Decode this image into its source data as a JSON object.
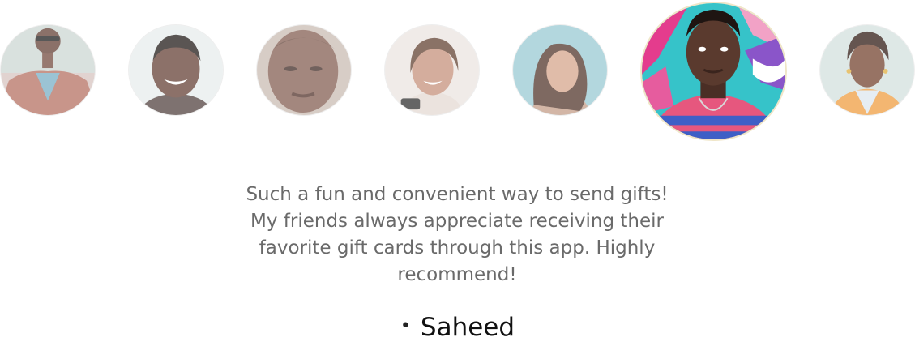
{
  "testimonial": {
    "quote": "Such a fun and convenient way to send gifts! My friends always appreciate receiving their favorite gift cards through this app. Highly recommend!",
    "author": "Saheed",
    "bullet": "•"
  },
  "avatars": [
    {
      "id": "avatar-1",
      "active": false
    },
    {
      "id": "avatar-2",
      "active": false
    },
    {
      "id": "avatar-3",
      "active": false
    },
    {
      "id": "avatar-4",
      "active": false
    },
    {
      "id": "avatar-5",
      "active": false
    },
    {
      "id": "avatar-6",
      "active": true
    },
    {
      "id": "avatar-7",
      "active": false
    }
  ],
  "colors": {
    "quote_text": "#6a6a6a",
    "author_text": "#111111",
    "active_ring": "#f0e6c8"
  }
}
